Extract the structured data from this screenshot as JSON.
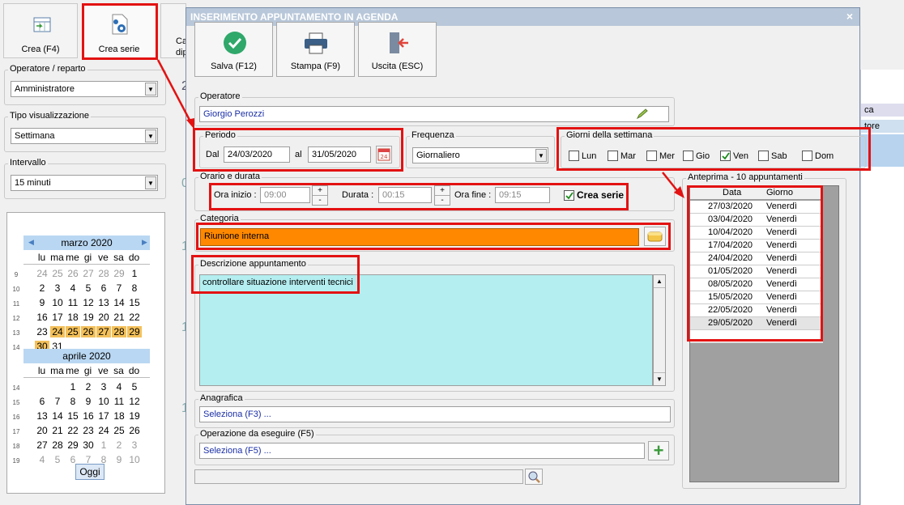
{
  "app": {
    "toolbar": {
      "crea": "Crea (F4)",
      "crea_serie": "Crea serie",
      "ca_partial": "Ca",
      "dip_partial": "dip"
    },
    "operatore_reparto": {
      "label": "Operatore / reparto",
      "value": "Amministratore"
    },
    "tipo_visualizzazione": {
      "label": "Tipo visualizzazione",
      "value": "Settimana"
    },
    "intervallo": {
      "label": "Intervallo",
      "value": "15 minuti"
    },
    "background_fragments": {
      "ca": "ca",
      "tore": "tore",
      "n2": "2",
      "n0": "0",
      "n1a": "1",
      "n1b": "1",
      "n1c": "1"
    },
    "calendar": {
      "march": {
        "title": "marzo 2020",
        "dow": [
          "lu",
          "ma",
          "me",
          "gi",
          "ve",
          "sa",
          "do"
        ],
        "weeks": [
          {
            "n": "9",
            "days": [
              "24",
              "25",
              "26",
              "27",
              "28",
              "29",
              "1"
            ]
          },
          {
            "n": "10",
            "days": [
              "2",
              "3",
              "4",
              "5",
              "6",
              "7",
              "8"
            ]
          },
          {
            "n": "11",
            "days": [
              "9",
              "10",
              "11",
              "12",
              "13",
              "14",
              "15"
            ]
          },
          {
            "n": "12",
            "days": [
              "16",
              "17",
              "18",
              "19",
              "20",
              "21",
              "22"
            ]
          },
          {
            "n": "13",
            "days": [
              "23",
              "24",
              "25",
              "26",
              "27",
              "28",
              "29"
            ]
          },
          {
            "n": "14",
            "days": [
              "30",
              "31"
            ]
          }
        ]
      },
      "april": {
        "title": "aprile 2020",
        "dow": [
          "lu",
          "ma",
          "me",
          "gi",
          "ve",
          "sa",
          "do"
        ],
        "weeks": [
          {
            "n": "14",
            "days": [
              "",
              "",
              "1",
              "2",
              "3",
              "4",
              "5"
            ]
          },
          {
            "n": "15",
            "days": [
              "6",
              "7",
              "8",
              "9",
              "10",
              "11",
              "12"
            ]
          },
          {
            "n": "16",
            "days": [
              "13",
              "14",
              "15",
              "16",
              "17",
              "18",
              "19"
            ]
          },
          {
            "n": "17",
            "days": [
              "20",
              "21",
              "22",
              "23",
              "24",
              "25",
              "26"
            ]
          },
          {
            "n": "18",
            "days": [
              "27",
              "28",
              "29",
              "30",
              "1",
              "2",
              "3"
            ]
          },
          {
            "n": "19",
            "days": [
              "4",
              "5",
              "6",
              "7",
              "8",
              "9",
              "10"
            ]
          }
        ]
      },
      "today_button": "Oggi"
    }
  },
  "dialog": {
    "title": "INSERIMENTO APPUNTAMENTO IN AGENDA",
    "close": "×",
    "buttons": {
      "salva": "Salva (F12)",
      "stampa": "Stampa (F9)",
      "uscita": "Uscita (ESC)"
    },
    "operatore": {
      "label": "Operatore",
      "value": "Giorgio Perozzi"
    },
    "periodo": {
      "label": "Periodo",
      "dal_label": "Dal",
      "dal": "24/03/2020",
      "al_label": "al",
      "al": "31/05/2020",
      "cal_icon_text": "24"
    },
    "frequenza": {
      "label": "Frequenza",
      "value": "Giornaliero"
    },
    "giorni": {
      "label": "Giorni della settimana",
      "days": [
        {
          "name": "Lun",
          "checked": false
        },
        {
          "name": "Mar",
          "checked": false
        },
        {
          "name": "Mer",
          "checked": false
        },
        {
          "name": "Gio",
          "checked": false
        },
        {
          "name": "Ven",
          "checked": true
        },
        {
          "name": "Sab",
          "checked": false
        },
        {
          "name": "Dom",
          "checked": false
        }
      ]
    },
    "orario": {
      "label": "Orario e durata",
      "ora_inizio_label": "Ora inizio :",
      "ora_inizio": "09:00",
      "durata_label": "Durata :",
      "durata": "00:15",
      "ora_fine_label": "Ora fine :",
      "ora_fine": "09:15",
      "crea_serie": "Crea serie",
      "plus": "+",
      "minus": "-"
    },
    "categoria": {
      "label": "Categoria",
      "value": "Riunione interna",
      "color": "#ff8800"
    },
    "descrizione": {
      "label": "Descrizione appuntamento",
      "value": "controllare situazione interventi tecnici",
      "bg": "#b4eef0"
    },
    "anagrafica": {
      "label": "Anagrafica",
      "value": "Seleziona (F3) ..."
    },
    "operazione": {
      "label": "Operazione da eseguire (F5)",
      "value": "Seleziona (F5) ...",
      "add": "+"
    },
    "anteprima": {
      "label": "Anteprima - 10 appuntamenti",
      "columns": [
        "Data",
        "Giorno"
      ],
      "rows": [
        [
          "27/03/2020",
          "Venerdì"
        ],
        [
          "03/04/2020",
          "Venerdì"
        ],
        [
          "10/04/2020",
          "Venerdì"
        ],
        [
          "17/04/2020",
          "Venerdì"
        ],
        [
          "24/04/2020",
          "Venerdì"
        ],
        [
          "01/05/2020",
          "Venerdì"
        ],
        [
          "08/05/2020",
          "Venerdì"
        ],
        [
          "15/05/2020",
          "Venerdì"
        ],
        [
          "22/05/2020",
          "Venerdì"
        ],
        [
          "29/05/2020",
          "Venerdì"
        ]
      ]
    }
  },
  "colors": {
    "highlight": "#e31212",
    "accent": "#f3c05a",
    "title_bar": "#b8c7d9"
  }
}
